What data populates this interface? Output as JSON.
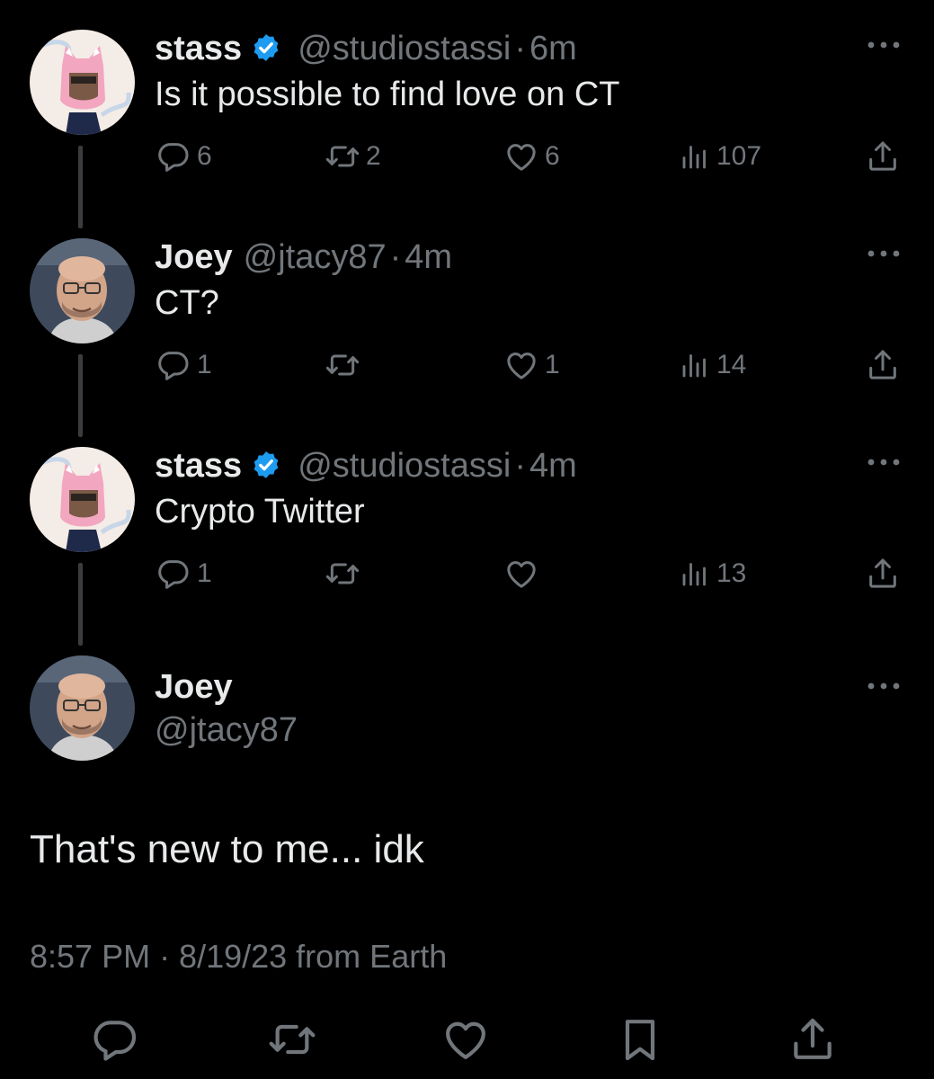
{
  "thread": [
    {
      "display_name": "stass",
      "verified": true,
      "handle": "@studiostassi",
      "separator": "·",
      "time": "6m",
      "text": "Is it possible to find love on CT",
      "avatar_icon": "cat-helmet-avatar",
      "stats": {
        "replies": "6",
        "retweets": "2",
        "likes": "6",
        "views": "107"
      }
    },
    {
      "display_name": "Joey",
      "verified": false,
      "handle": "@jtacy87",
      "separator": "·",
      "time": "4m",
      "text": "CT?",
      "avatar_icon": "man-with-glasses-avatar",
      "stats": {
        "replies": "1",
        "retweets": "",
        "likes": "1",
        "views": "14"
      }
    },
    {
      "display_name": "stass",
      "verified": true,
      "handle": "@studiostassi",
      "separator": "·",
      "time": "4m",
      "text": "Crypto Twitter",
      "avatar_icon": "cat-helmet-avatar",
      "stats": {
        "replies": "1",
        "retweets": "",
        "likes": "",
        "views": "13"
      }
    }
  ],
  "focused_tweet": {
    "display_name": "Joey",
    "handle": "@jtacy87",
    "text": "That's new to me... idk",
    "timestamp": "8:57 PM · 8/19/23 from Earth",
    "avatar_icon": "man-with-glasses-avatar"
  },
  "bottom_actions": [
    "reply-icon",
    "retweet-icon",
    "like-icon",
    "bookmark-icon",
    "share-icon"
  ],
  "colors": {
    "background": "#000000",
    "primary_text": "#e7e9ea",
    "secondary_text": "#71767b",
    "verified_blue": "#1d9bf0",
    "thread_line": "#3a3d40"
  }
}
